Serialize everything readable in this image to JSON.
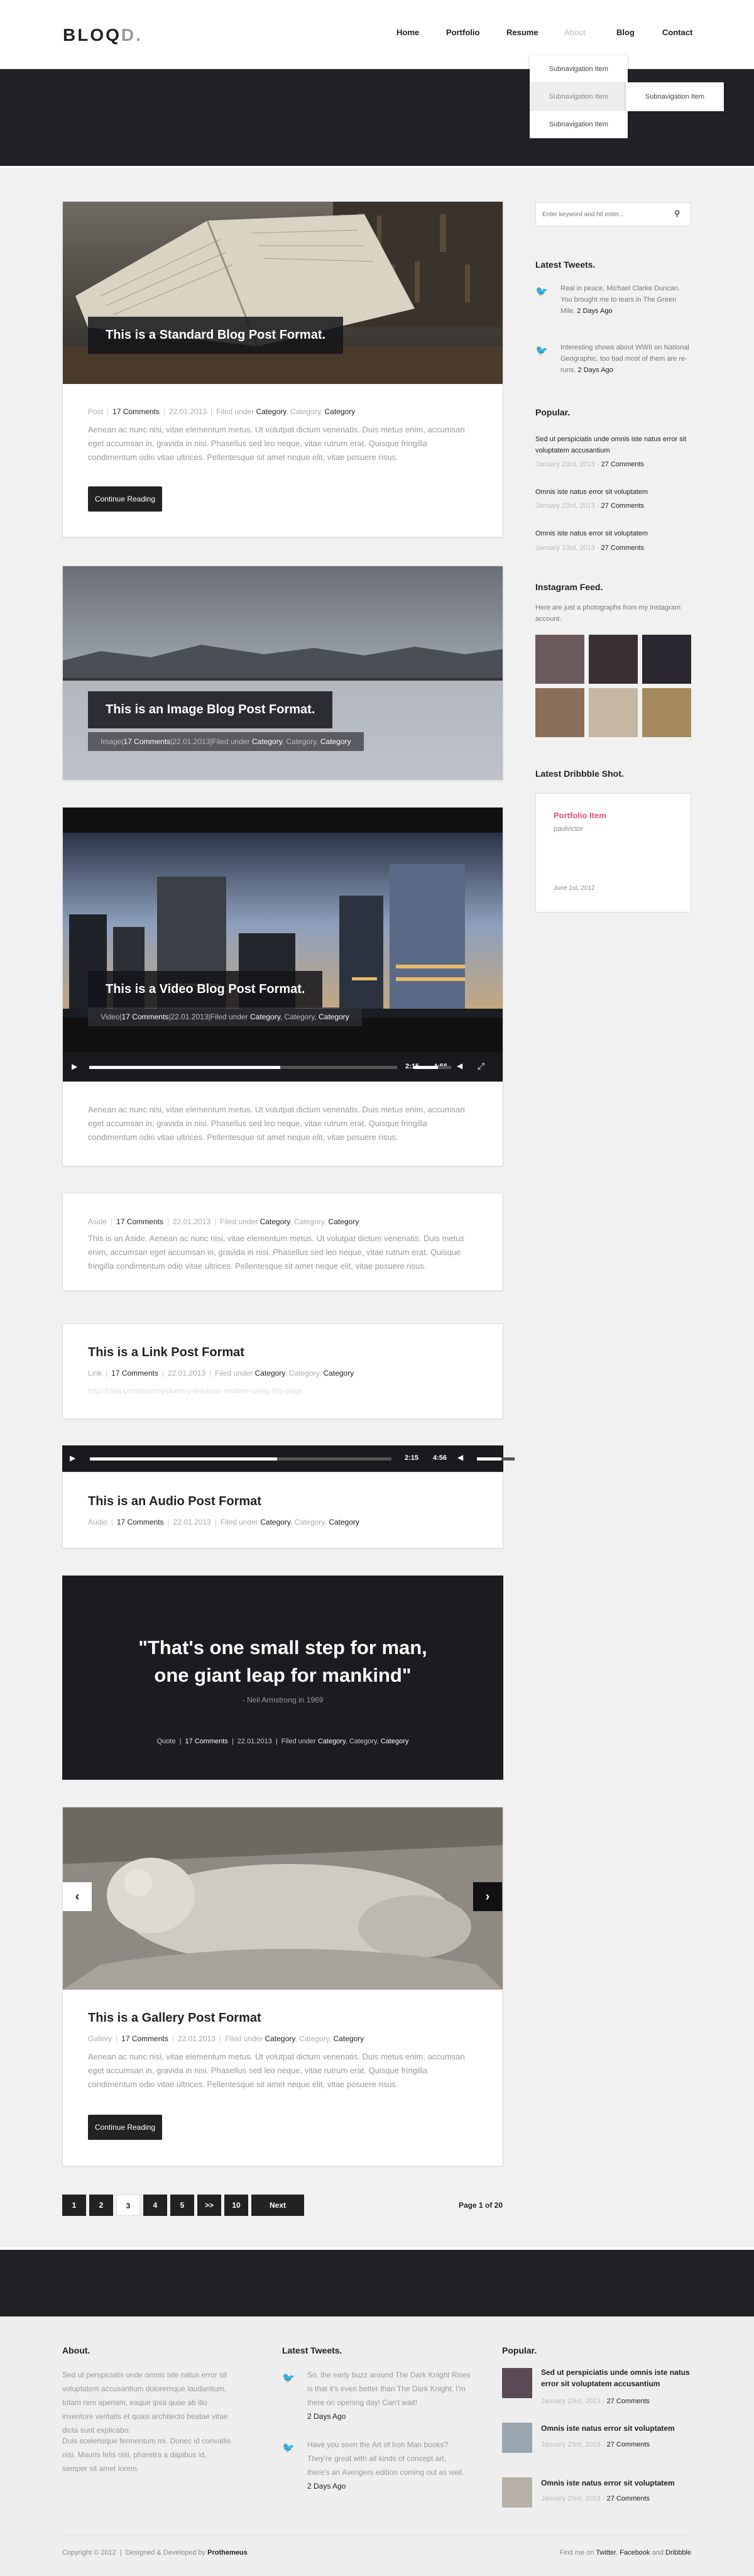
{
  "header": {
    "logo": "BLOQ",
    "logo_accent": "D.",
    "nav": [
      "Home",
      "Portfolio",
      "Resume",
      "About",
      "Blog",
      "Contact"
    ],
    "submenu": [
      "Subnavigation Item",
      "Subnavigation Item",
      "Subnavigation Item"
    ],
    "submenu2": "Subnavigation Item"
  },
  "posts": {
    "standard": {
      "title": "This is a Standard Blog Post Format.",
      "format": "Post",
      "comments": "17 Comments",
      "date": "22.01.2013",
      "filed": "Filed under",
      "cats": [
        "Category",
        "Category",
        "Category"
      ],
      "excerpt": "Aenean ac nunc nisi, vitae elementum metus. Ut volutpat dictum venenatis. Duis metus enim, accumsan eget accumsan in, gravida in nisi. Phasellus sed leo neque, vitae rutrum erat. Quisque fringilla condimentum odio vitae ultrices. Pellentesque sit amet neque elit, vitae posuere risus.",
      "button": "Continue Reading"
    },
    "image": {
      "title": "This is an Image Blog Post Format.",
      "format": "Image",
      "comments": "17 Comments",
      "date": "22.01.2013",
      "filed": "Filed under",
      "cats": [
        "Category",
        "Category",
        "Category"
      ]
    },
    "video": {
      "title": "This is a Video Blog Post Format.",
      "format": "Video",
      "comments": "17 Comments",
      "date": "22.01.2013",
      "filed": "Filed under",
      "cats": [
        "Category",
        "Category",
        "Category"
      ],
      "time": "2:15",
      "duration": "4:56",
      "progress": 0.62,
      "volume": 0.65,
      "excerpt": "Aenean ac nunc nisi, vitae elementum metus. Ut volutpat dictum venenatis. Duis metus enim, accumsan eget accumsan in, gravida in nisi. Phasellus sed leo neque, vitae rutrum erat. Quisque fringilla condimentum odio vitae ultrices. Pellentesque sit amet neque elit, vitae posuere risus."
    },
    "aside": {
      "format": "Aside",
      "comments": "17 Comments",
      "date": "22.01.2013",
      "filed": "Filed under",
      "cats": [
        "Category",
        "Category",
        "Category"
      ],
      "excerpt": "This is an Aside. Aenean ac nunc nisi, vitae elementum metus. Ut volutpat dictum venenatis. Duis metus enim, accumsan eget accumsan in, gravida in nisi. Phasellus sed leo neque, vitae rutrum erat. Quisque fringilla condimentum odio vitae ultrices. Pellentesque sit amet neque elit, vitae posuere risus."
    },
    "link": {
      "title": "This is a Link Post Format",
      "format": "Link",
      "comments": "17 Comments",
      "date": "22.01.2013",
      "filed": "Filed under",
      "cats": [
        "Category",
        "Category",
        "Category"
      ],
      "url": "http://bloq.com/dummy/dummy-link/post-relation-using-this-page"
    },
    "audio": {
      "title": "This is an Audio Post Format",
      "format": "Audio",
      "comments": "17 Comments",
      "date": "22.01.2013",
      "filed": "Filed under",
      "cats": [
        "Category",
        "Category",
        "Category"
      ],
      "time": "2:15",
      "duration": "4:56",
      "progress": 0.62,
      "volume": 0.65
    },
    "quote": {
      "line1": "\"That's one small step for man,",
      "line2": "one giant leap for mankind\"",
      "author": "- Neil Armstrong in 1969",
      "format": "Quote",
      "comments": "17 Comments",
      "date": "22.01.2013",
      "filed": "Filed under",
      "cats": [
        "Category",
        "Category",
        "Category"
      ]
    },
    "gallery": {
      "title": "This is a Gallery Post Format",
      "format": "Gallery",
      "comments": "17 Comments",
      "date": "22.01.2013",
      "filed": "Filed under",
      "cats": [
        "Category",
        "Category",
        "Category"
      ],
      "excerpt": "Aenean ac nunc nisi, vitae elementum metus. Ut volutpat dictum venenatis. Duis metus enim, accumsan eget accumsan in, gravida in nisi. Phasellus sed leo neque, vitae rutrum erat. Quisque fringilla condimentum odio vitae ultrices. Pellentesque sit amet neque elit, vitae posuere risus.",
      "button": "Continue Reading"
    }
  },
  "pagination": {
    "pages": [
      "1",
      "2",
      "3",
      "4",
      "5",
      ">>",
      "10"
    ],
    "next": "Next",
    "info": "Page 1 of 20"
  },
  "sidebar": {
    "search_placeholder": "Enter keyword and hit enter...",
    "tweets_title": "Latest Tweets.",
    "tweets": [
      {
        "text": "Real in peace, Michael Clarke Duncan. You brought me to tears in The Green Mile.",
        "time": "2 Days Ago"
      },
      {
        "text": "Interesting shows about WWII on National Geographic, too bad most of them are re-runs.",
        "time": "2 Days Ago"
      }
    ],
    "popular_title": "Popular.",
    "popular": [
      {
        "title": "Sed ut perspiciatis unde omnis iste natus error sit voluptatem accusantium",
        "date": "January 23rd, 2013",
        "comments": "27 Comments"
      },
      {
        "title": "Omnis iste natus error sit voluptatem",
        "date": "January 23rd, 2013",
        "comments": "27 Comments"
      },
      {
        "title": "Omnis iste natus error sit voluptatem",
        "date": "January 23rd, 2013",
        "comments": "27 Comments"
      }
    ],
    "instagram_title": "Instagram Feed.",
    "instagram_text": "Here are just a photographs from my Instagram account.",
    "dribbble_title": "Latest Dribbble Shot.",
    "dribbble": {
      "title": "Portfolio Item",
      "author": "paulvictor",
      "date": "June 1st, 2012"
    }
  },
  "footer": {
    "about_title": "About.",
    "about_p1": "Sed ut perspiciatis unde omnis iste natus error sit voluptatem accusantium doloremque laudantium, totam rem aperiam, eaque ipsa quae ab illo inventore veritatis et quasi architecto beatae vitae dicta sunt explicabo.",
    "about_p2": "Duis scelerisque fermentum mi. Donec id convallis nisi. Mauris felis nisi, pharetra a dapibus id, semper sit amet lorem.",
    "tweets_title": "Latest Tweets.",
    "tweets": [
      {
        "text": "So, the early buzz around The Dark Knight Rises is that it's even better than The Dark Knight. I'm there on opening day! Can't wait!",
        "time": "2 Days Ago"
      },
      {
        "text": "Have you seen the Art of Iron Man books? They're great with all kinds of concept art, there's an Avengers edition coming out as well.",
        "time": "2 Days Ago"
      }
    ],
    "popular_title": "Popular.",
    "popular": [
      {
        "title": "Sed ut perspiciatis unde omnis iste natus error sit voluptatem accusantium",
        "date": "January 23rd, 2013",
        "comments": "27 Comments"
      },
      {
        "title": "Omnis iste natus error sit voluptatem",
        "date": "January 23rd, 2013",
        "comments": "27 Comments"
      },
      {
        "title": "Omnis iste natus error sit voluptatem",
        "date": "January 23rd, 2013",
        "comments": "27 Comments"
      }
    ],
    "copyright": "Copyright © 2012  |  Designed & Developed by",
    "author": "Prothemeus",
    "find": "Find me on",
    "twitter": "Twitter",
    "facebook": "Facebook",
    "and": "and",
    "dribbble": "Dribbble"
  }
}
